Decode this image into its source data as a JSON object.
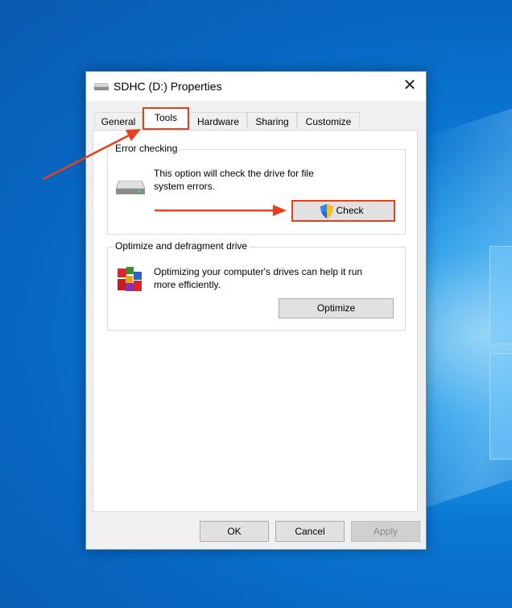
{
  "window": {
    "title": "SDHC (D:) Properties",
    "close_label": "✕"
  },
  "tabs": [
    {
      "label": "General",
      "active": false
    },
    {
      "label": "Tools",
      "active": true
    },
    {
      "label": "Hardware",
      "active": false
    },
    {
      "label": "Sharing",
      "active": false
    },
    {
      "label": "Customize",
      "active": false
    }
  ],
  "error_checking": {
    "title": "Error checking",
    "description_line1": "This option will check the drive for file",
    "description_line2": "system errors.",
    "check_label": "Check"
  },
  "optimize": {
    "title": "Optimize and defragment drive",
    "description_line1": "Optimizing your computer's drives can help it run",
    "description_line2": "more efficiently.",
    "optimize_label": "Optimize"
  },
  "footer": {
    "ok_label": "OK",
    "cancel_label": "Cancel",
    "apply_label": "Apply"
  },
  "colors": {
    "annotation": "#e8401c",
    "desktop": "#0a78d4"
  },
  "icons": {
    "title": "drive-icon",
    "error_checking": "drive-icon",
    "check_button": "uac-shield-icon",
    "optimize": "defrag-icon"
  }
}
